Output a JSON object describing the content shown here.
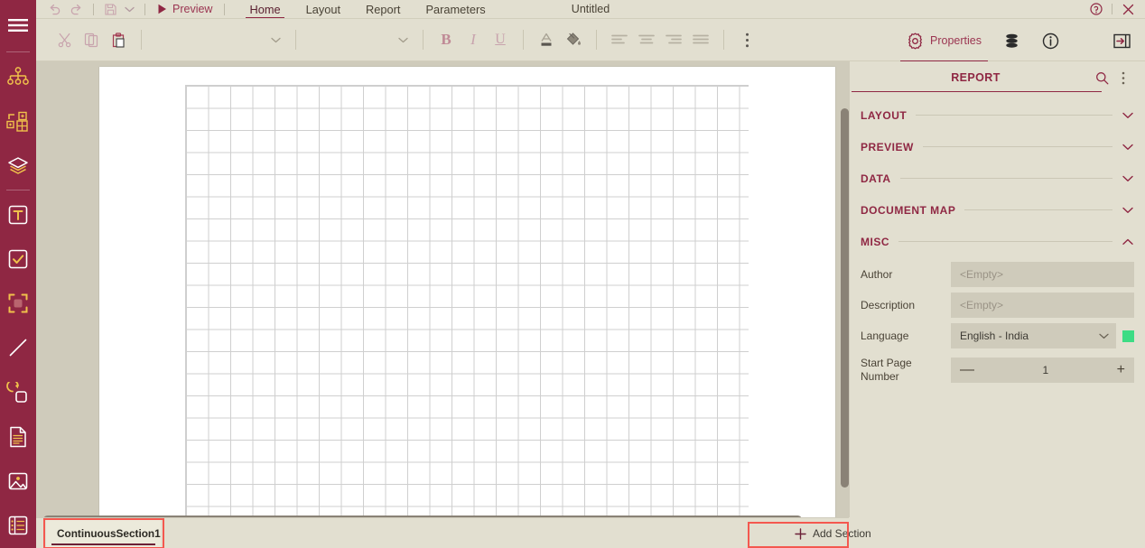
{
  "app": {
    "document_title": "Untitled",
    "accent_color": "#8f2743",
    "sidebar_color": "#8f2743",
    "panel_bg": "#e2dfd0",
    "highlight_color": "#f4584f"
  },
  "sidebar": {
    "items": [
      {
        "name": "menu-icon",
        "label": "Menu"
      },
      {
        "name": "hierarchy-icon",
        "label": "Hierarchy"
      },
      {
        "name": "table-grid-icon",
        "label": "Table"
      },
      {
        "name": "layers-icon",
        "label": "Layers"
      },
      {
        "name": "textbox-icon",
        "label": "TextBox"
      },
      {
        "name": "checkbox-icon",
        "label": "CheckBox"
      },
      {
        "name": "container-icon",
        "label": "Container"
      },
      {
        "name": "line-icon",
        "label": "Line"
      },
      {
        "name": "shape-icon",
        "label": "Shape"
      },
      {
        "name": "document-icon",
        "label": "Document"
      },
      {
        "name": "image-icon",
        "label": "Image"
      },
      {
        "name": "list-icon",
        "label": "List"
      }
    ]
  },
  "topbar": {
    "undo_label": "Undo",
    "redo_label": "Redo",
    "save_label": "Save",
    "save_dropdown_label": "Save options",
    "preview_label": "Preview",
    "tabs": [
      {
        "label": "Home",
        "active": true
      },
      {
        "label": "Layout",
        "active": false
      },
      {
        "label": "Report",
        "active": false
      },
      {
        "label": "Parameters",
        "active": false
      }
    ],
    "help_label": "Help",
    "close_label": "Close"
  },
  "toolbar": {
    "cut_label": "Cut",
    "copy_label": "Copy",
    "paste_label": "Paste",
    "font_family_value": "",
    "font_family_placeholder": "",
    "font_size_value": "",
    "font_size_placeholder": "",
    "bold_label": "B",
    "italic_label": "I",
    "underline_label": "U",
    "font_color_label": "A",
    "fill_color_label": "Fill Color",
    "align_left_label": "Align Left",
    "align_center_label": "Align Center",
    "align_right_label": "Align Right",
    "align_justify_label": "Justify",
    "more_label": "More options"
  },
  "panel_tabs": [
    {
      "label": "Properties",
      "icon": "gear-icon",
      "active": true
    },
    {
      "label": "",
      "icon": "database-icon",
      "active": false
    },
    {
      "label": "",
      "icon": "info-icon",
      "active": false
    }
  ],
  "collapse_panel_label": "Collapse Panel",
  "properties": {
    "header_title": "REPORT",
    "search_label": "Search",
    "more_label": "More",
    "sections": [
      {
        "label": "LAYOUT",
        "expanded": false
      },
      {
        "label": "PREVIEW",
        "expanded": false
      },
      {
        "label": "DATA",
        "expanded": false
      },
      {
        "label": "DOCUMENT MAP",
        "expanded": false
      },
      {
        "label": "MISC",
        "expanded": true
      }
    ],
    "misc_fields": {
      "author": {
        "label": "Author",
        "value": "",
        "placeholder": "<Empty>"
      },
      "description": {
        "label": "Description",
        "value": "",
        "placeholder": "<Empty>"
      },
      "language": {
        "label": "Language",
        "value": "English - India",
        "swatch_color": "#3ddc84"
      },
      "start_page_number": {
        "label": "Start Page Number",
        "value": "1",
        "decrement_label": "—",
        "increment_label": "+"
      }
    }
  },
  "canvas": {
    "zoom_note": ""
  },
  "bottom": {
    "section_tab_label": "ContinuousSection1",
    "add_section_label": "Add Section",
    "add_section_icon": "plus-icon"
  }
}
